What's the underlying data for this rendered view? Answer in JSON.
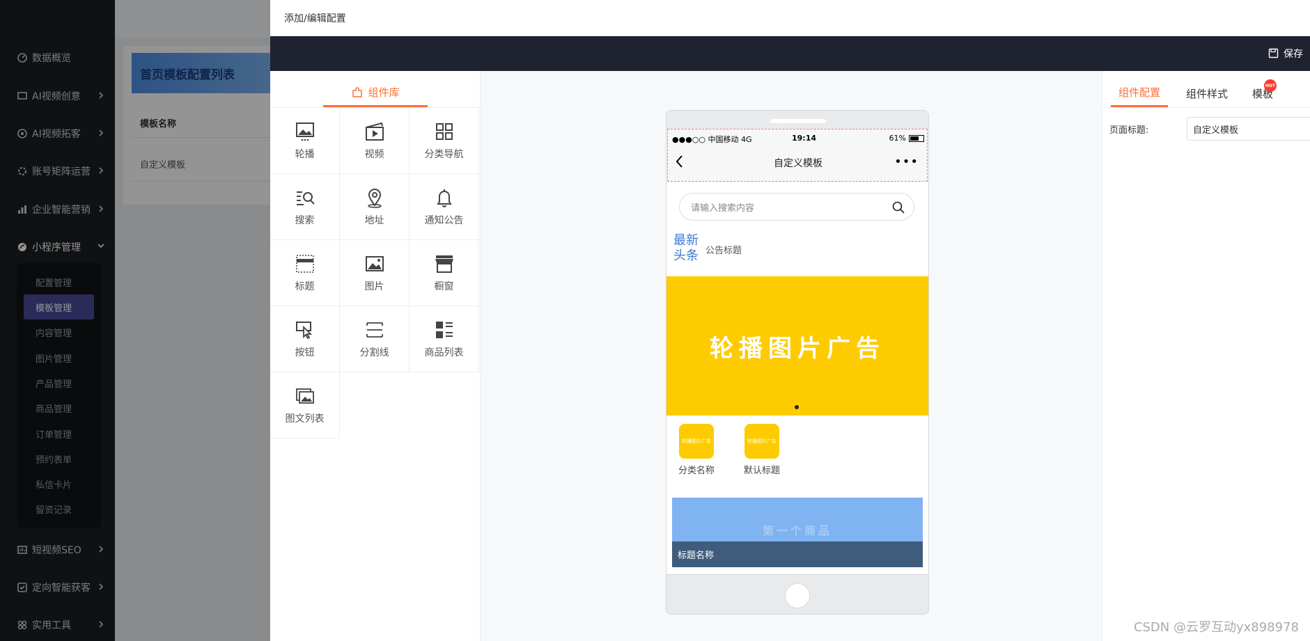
{
  "sidebar": {
    "items": [
      {
        "label": "数据概览",
        "icon": "dashboard-icon",
        "chevron": false
      },
      {
        "label": "AI视频创意",
        "icon": "video-idea-icon",
        "chevron": true
      },
      {
        "label": "AI视频拓客",
        "icon": "target-icon",
        "chevron": true
      },
      {
        "label": "账号矩阵运营",
        "icon": "matrix-icon",
        "chevron": true
      },
      {
        "label": "企业智能营销",
        "icon": "chart-bar-icon",
        "chevron": true
      },
      {
        "label": "小程序管理",
        "icon": "mini-program-icon",
        "chevron": "down"
      },
      {
        "label": "短视频SEO",
        "icon": "seo-icon",
        "chevron": true
      },
      {
        "label": "定向智能获客",
        "icon": "acquire-icon",
        "chevron": true
      },
      {
        "label": "实用工具",
        "icon": "tools-icon",
        "chevron": true
      }
    ],
    "submenu": [
      "配置管理",
      "模板管理",
      "内容管理",
      "图片管理",
      "产品管理",
      "商品管理",
      "订单管理",
      "预约表单",
      "私信卡片",
      "留资记录"
    ]
  },
  "base": {
    "card_title": "首页模板配置列表",
    "table_header": "模板名称",
    "table_row": "自定义模板"
  },
  "drawer": {
    "title": "添加/编辑配置",
    "save_label": "保存"
  },
  "library": {
    "tab_label": "组件库",
    "components": [
      {
        "label": "轮播",
        "icon": "image-carousel-icon"
      },
      {
        "label": "视频",
        "icon": "video-clapper-icon"
      },
      {
        "label": "分类导航",
        "icon": "grid-icon"
      },
      {
        "label": "搜索",
        "icon": "search-list-icon"
      },
      {
        "label": "地址",
        "icon": "location-pin-icon"
      },
      {
        "label": "通知公告",
        "icon": "bell-icon"
      },
      {
        "label": "标题",
        "icon": "title-icon"
      },
      {
        "label": "图片",
        "icon": "image-icon"
      },
      {
        "label": "橱窗",
        "icon": "storefront-icon"
      },
      {
        "label": "按钮",
        "icon": "pointer-click-icon"
      },
      {
        "label": "分割线",
        "icon": "divider-icon"
      },
      {
        "label": "商品列表",
        "icon": "product-list-icon"
      },
      {
        "label": "图文列表",
        "icon": "gallery-icon"
      }
    ]
  },
  "phone": {
    "carrier": "●●●○○ 中国移动  4G",
    "time": "19:14",
    "battery": "61%",
    "nav_title": "自定义模板",
    "more": "•••",
    "search_placeholder": "请输入搜索内容",
    "notice_big": "最新头条",
    "notice_text": "公告标题",
    "banner_text": "轮播图片广告",
    "categories": [
      {
        "thumb_text": "轮播图片广告",
        "label": "分类名称"
      },
      {
        "thumb_text": "轮播图片广告",
        "label": "默认标题"
      }
    ],
    "product_watermark": "第一个商品",
    "product_title": "标题名称"
  },
  "config": {
    "tabs": [
      "组件配置",
      "组件样式",
      "模板"
    ],
    "hot_badge": "HOT",
    "field_label": "页面标题:",
    "field_value": "自定义模板"
  },
  "watermark": "CSDN @云罗互动yx898978",
  "colors": {
    "accent": "#ff6e35",
    "banner": "#fecb00",
    "sidebar": "#1b1e22",
    "savebar": "#1f2330",
    "active_submenu": "#4b4a9a"
  }
}
